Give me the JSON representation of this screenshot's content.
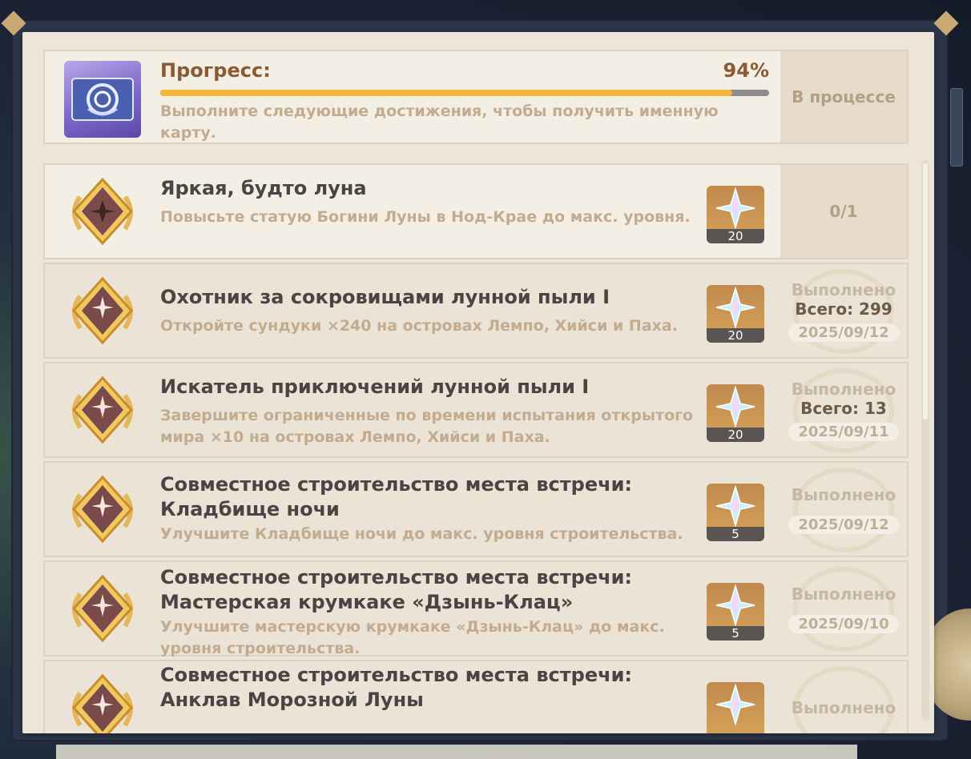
{
  "header": {
    "title": "Прогресс:",
    "percent": "94%",
    "progress_value": 0.94,
    "description": "Выполните следующие достижения, чтобы получить именную карту.",
    "status": "В процессе",
    "icon": "namecard-icon"
  },
  "achievements": [
    {
      "title": "Яркая, будто луна",
      "description": "Повысьте статую Богини Луны в Нод-Крае до макс. уровня.",
      "reward_icon": "primogem-icon",
      "reward_count": "20",
      "status": "0/1"
    },
    {
      "title": "Охотник за сокровищами лунной пыли I",
      "description": "Откройте сундуки ×240 на островах Лемпо, Хийси и Паха.",
      "reward_icon": "primogem-icon",
      "reward_count": "20",
      "status": "Выполнено",
      "total": "Всего: 299",
      "date": "2025/09/12"
    },
    {
      "title": "Искатель приключений лунной пыли I",
      "description": "Завершите ограниченные по времени испытания открытого мира ×10 на островах Лемпо, Хийси и Паха.",
      "reward_icon": "primogem-icon",
      "reward_count": "20",
      "status": "Выполнено",
      "total": "Всего: 13",
      "date": "2025/09/11"
    },
    {
      "title": "Совместное строительство места встречи: Кладбище ночи",
      "description": "Улучшите Кладбище ночи до макс. уровня строительства.",
      "reward_icon": "primogem-icon",
      "reward_count": "5",
      "status": "Выполнено",
      "date": "2025/09/12"
    },
    {
      "title": "Совместное строительство места встречи: Мастерская крумкаке «Дзынь-Клац»",
      "description": "Улучшите мастерскую крумкаке «Дзынь-Клац» до макс. уровня строительства.",
      "reward_icon": "primogem-icon",
      "reward_count": "5",
      "status": "Выполнено",
      "date": "2025/09/10"
    },
    {
      "title": "Совместное строительство места встречи: Анклав Морозной Луны",
      "description": "",
      "reward_icon": "primogem-icon",
      "reward_count": "",
      "status": "Выполнено"
    }
  ],
  "colors": {
    "panel_bg": "#ece5d8",
    "accent_brown": "#8a5a35",
    "progress_fill": "#f0b63a",
    "muted_text": "#c3ab8f",
    "title_text": "#4a4445"
  }
}
